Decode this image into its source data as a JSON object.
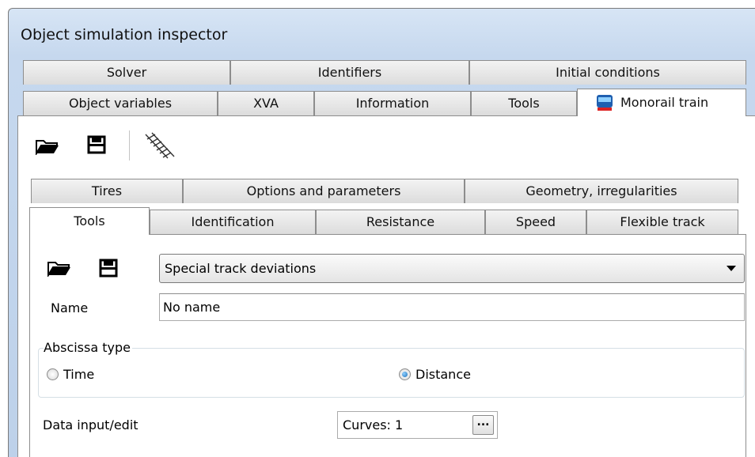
{
  "window": {
    "title": "Object simulation inspector"
  },
  "outer_tabs": {
    "row1": [
      "Solver",
      "Identifiers",
      "Initial conditions"
    ],
    "row2": [
      "Object variables",
      "XVA",
      "Information",
      "Tools",
      "Monorail train"
    ],
    "active": "Monorail train"
  },
  "toolbar": {
    "icons": [
      "open-folder-icon",
      "save-icon",
      "track-icon"
    ]
  },
  "inner_tabs": {
    "row1": [
      "Tires",
      "Options and parameters",
      "Geometry, irregularities"
    ],
    "row2": [
      "Tools",
      "Identification",
      "Resistance",
      "Speed",
      "Flexible track"
    ],
    "active": "Tools"
  },
  "tools_panel": {
    "preset_combo": "Special track deviations",
    "name_label": "Name",
    "name_value": "No name",
    "abscissa_group": "Abscissa type",
    "abscissa_options": [
      "Time",
      "Distance"
    ],
    "abscissa_selected": "Distance",
    "data_input_label": "Data input/edit",
    "curves_value": "Curves: 1",
    "ellipsis": "..."
  }
}
